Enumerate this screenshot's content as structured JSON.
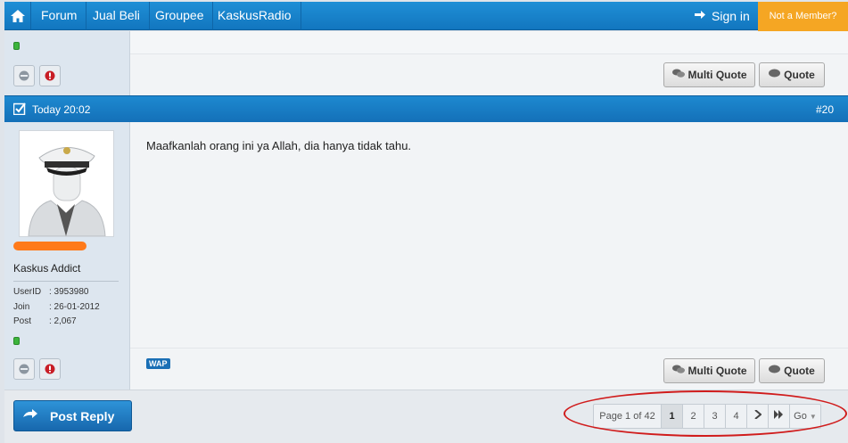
{
  "nav": {
    "items": [
      "Forum",
      "Jual Beli",
      "Groupee",
      "KaskusRadio"
    ],
    "signin": "Sign in",
    "member": "Not a Member?"
  },
  "buttons": {
    "multi_quote": "Multi Quote",
    "quote": "Quote",
    "post_reply": "Post Reply"
  },
  "post": {
    "time": "Today 20:02",
    "number": "#20",
    "message": "Maafkanlah orang ini ya Allah, dia hanya tidak tahu.",
    "rank": "Kaskus Addict",
    "stats": [
      {
        "label": "UserID",
        "value": ": 3953980"
      },
      {
        "label": "Join",
        "value": ": 26-01-2012"
      },
      {
        "label": "Post",
        "value": ": 2,067"
      }
    ],
    "wap": "WAP"
  },
  "pager": {
    "label": "Page 1 of 42",
    "pages": [
      "1",
      "2",
      "3",
      "4"
    ],
    "go": "Go"
  },
  "colors": {
    "brand": "#1276bf",
    "accent": "#f5a623",
    "annotation": "#d01c1c"
  }
}
